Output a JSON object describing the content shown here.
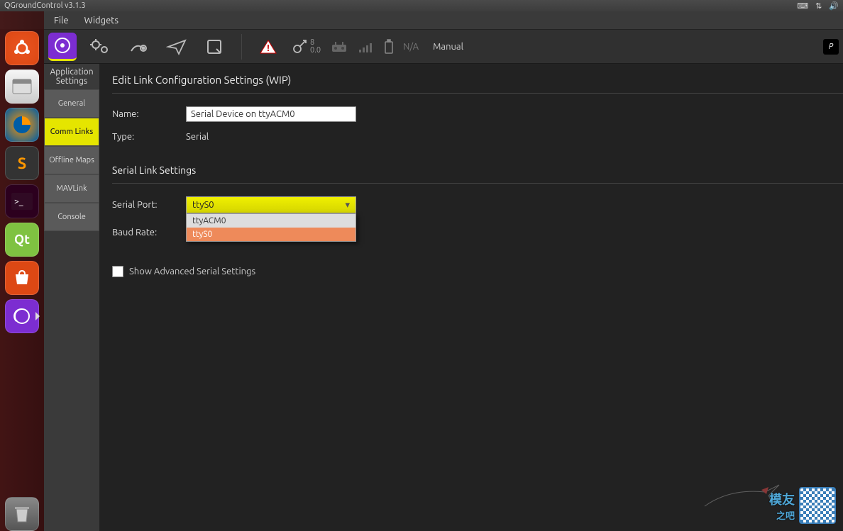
{
  "titlebar": {
    "title": "QGroundControl v3.1.3"
  },
  "menubar": {
    "file": "File",
    "widgets": "Widgets"
  },
  "toolbar": {
    "sat_count": "8",
    "sat_hdop": "0.0",
    "na": "N/A",
    "mode": "Manual"
  },
  "sidebar": {
    "header_line1": "Application",
    "header_line2": "Settings",
    "items": [
      {
        "label": "General"
      },
      {
        "label": "Comm Links"
      },
      {
        "label": "Offline Maps"
      },
      {
        "label": "MAVLink"
      },
      {
        "label": "Console"
      }
    ]
  },
  "panel": {
    "title": "Edit Link Configuration Settings (WIP)",
    "name_label": "Name:",
    "name_value": "Serial Device on ttyACM0",
    "type_label": "Type:",
    "type_value": "Serial",
    "serial_section": "Serial Link Settings",
    "port_label": "Serial Port:",
    "port_selected": "ttyS0",
    "port_options": [
      {
        "label": "ttyACM0"
      },
      {
        "label": "ttyS0"
      }
    ],
    "baud_label": "Baud Rate:",
    "advanced_label": "Show Advanced Serial Settings"
  },
  "watermark": {
    "text1": "模友",
    "text2": "之吧"
  }
}
